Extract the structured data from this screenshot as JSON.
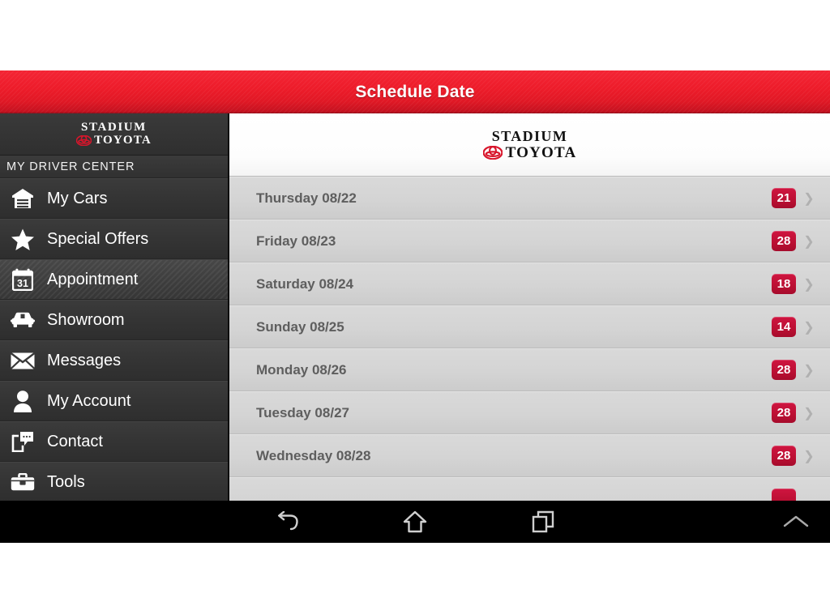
{
  "titlebar": {
    "title": "Schedule Date"
  },
  "sidebar": {
    "logo": {
      "line1": "STADIUM",
      "line2": "TOYOTA",
      "emblem_icon": "toyota-emblem-icon"
    },
    "section_header": "MY DRIVER CENTER",
    "items": [
      {
        "label": "My Cars",
        "icon": "garage-icon",
        "active": false
      },
      {
        "label": "Special Offers",
        "icon": "star-icon",
        "active": false
      },
      {
        "label": "Appointment",
        "icon": "calendar-icon",
        "active": true,
        "icon_day": "31"
      },
      {
        "label": "Showroom",
        "icon": "car-icon",
        "active": false
      },
      {
        "label": "Messages",
        "icon": "envelope-icon",
        "active": false
      },
      {
        "label": "My Account",
        "icon": "person-icon",
        "active": false
      },
      {
        "label": "Contact",
        "icon": "chat-phone-icon",
        "active": false
      },
      {
        "label": "Tools",
        "icon": "toolbox-icon",
        "active": false
      }
    ]
  },
  "content": {
    "logo": {
      "line1": "STADIUM",
      "line2": "TOYOTA",
      "emblem_icon": "toyota-emblem-icon"
    },
    "rows": [
      {
        "date": "Thursday 08/22",
        "count": "21"
      },
      {
        "date": "Friday 08/23",
        "count": "28"
      },
      {
        "date": "Saturday 08/24",
        "count": "18"
      },
      {
        "date": "Sunday 08/25",
        "count": "14"
      },
      {
        "date": "Monday 08/26",
        "count": "28"
      },
      {
        "date": "Tuesday 08/27",
        "count": "28"
      },
      {
        "date": "Wednesday 08/28",
        "count": "28"
      },
      {
        "date": "",
        "count": ""
      }
    ],
    "chevron_glyph": "❯"
  },
  "navbar": {
    "buttons": [
      {
        "name": "back-icon"
      },
      {
        "name": "home-icon"
      },
      {
        "name": "recent-apps-icon"
      }
    ],
    "expand": {
      "name": "chevron-up-icon"
    }
  },
  "colors": {
    "brand_red": "#ed1c2a",
    "badge_red": "#bb0f33",
    "sidebar_dark": "#333333",
    "list_gray": "#d4d4d4"
  }
}
